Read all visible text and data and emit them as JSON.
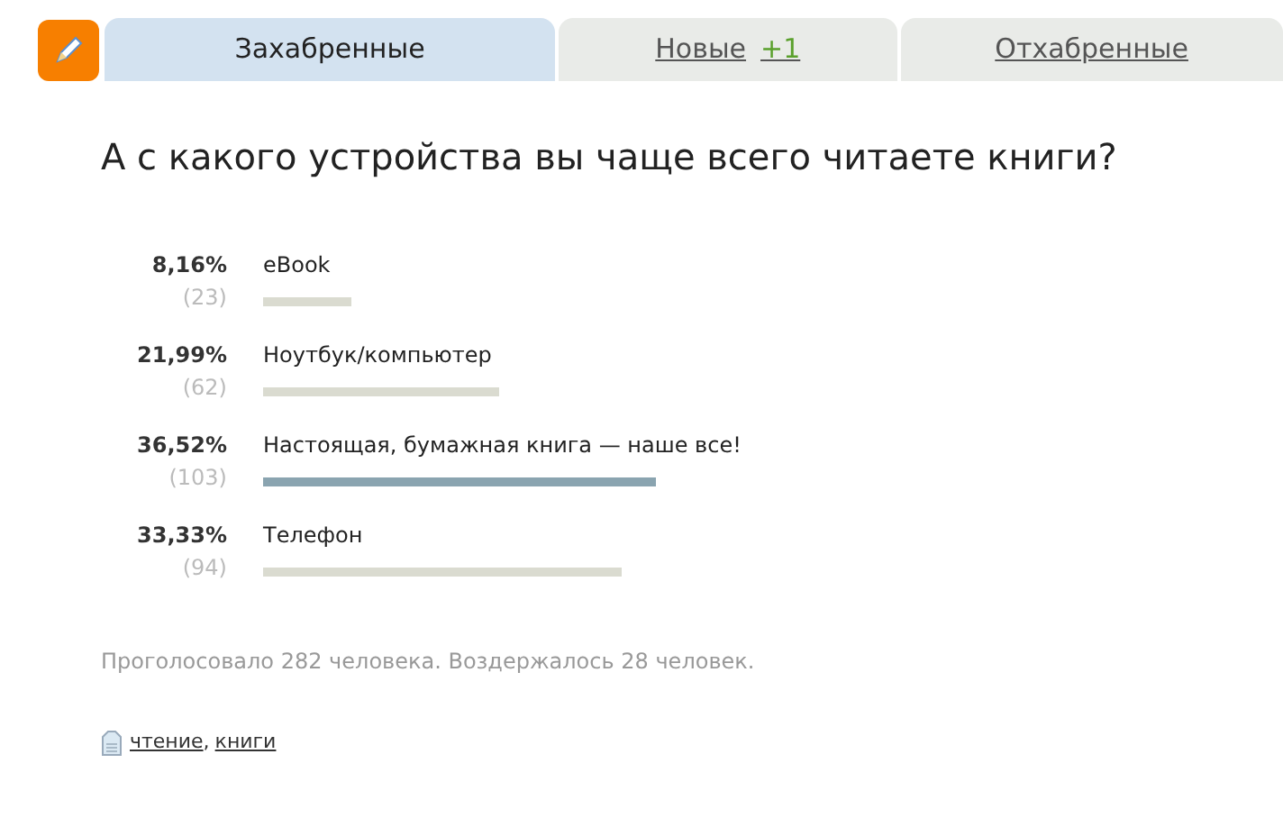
{
  "tabs": [
    {
      "label": "Захабренные",
      "selected": true
    },
    {
      "label": "Новые",
      "count": "+1",
      "selected": false
    },
    {
      "label": "Отхабренные",
      "selected": false
    }
  ],
  "poll": {
    "question": "А с какого устройства вы чаще всего читаете книги?",
    "options": [
      {
        "percent": "8,16%",
        "votes": "(23)",
        "label": "eBook",
        "leader": false
      },
      {
        "percent": "21,99%",
        "votes": "(62)",
        "label": "Ноутбук/компьютер",
        "leader": false
      },
      {
        "percent": "36,52%",
        "votes": "(103)",
        "label": "Настоящая, бумажная книга — наше все!",
        "leader": true
      },
      {
        "percent": "33,33%",
        "votes": "(94)",
        "label": "Телефон",
        "leader": false
      }
    ],
    "summary": "Проголосовало 282 человека. Воздержалось 28 человек.",
    "tags": [
      "чтение",
      "книги"
    ],
    "tag_separator": ","
  }
}
